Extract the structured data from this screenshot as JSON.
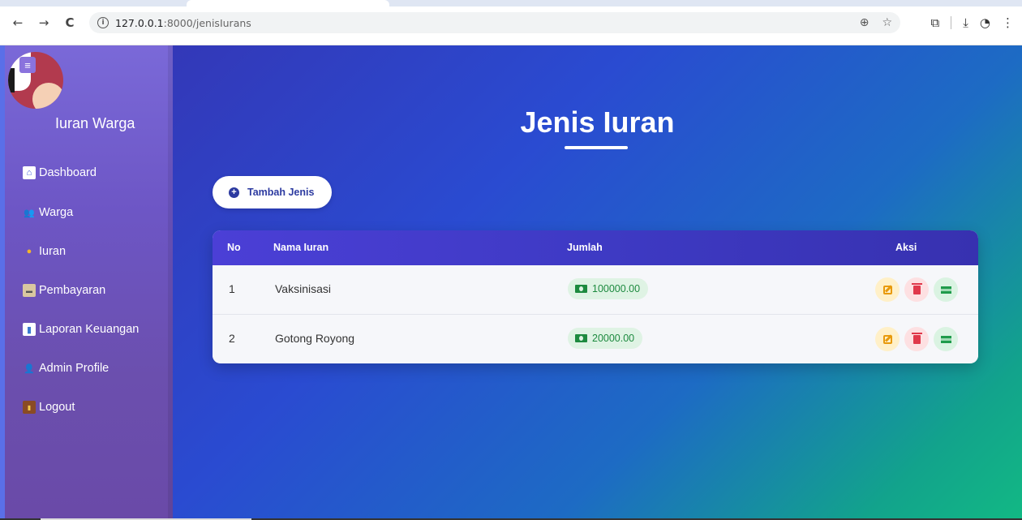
{
  "browser": {
    "url_host": "127.0.0.1",
    "url_path": ":8000/jenisIurans",
    "back_icon": "←",
    "forward_icon": "→",
    "reload_icon": "C"
  },
  "sidebar": {
    "brand": "Iuran Warga",
    "items": [
      {
        "label": "Dashboard",
        "icon": "home-icon"
      },
      {
        "label": "Warga",
        "icon": "users-icon"
      },
      {
        "label": "Iuran",
        "icon": "money-bag-icon"
      },
      {
        "label": "Pembayaran",
        "icon": "card-icon"
      },
      {
        "label": "Laporan Keuangan",
        "icon": "chart-icon"
      },
      {
        "label": "Admin Profile",
        "icon": "user-icon"
      },
      {
        "label": "Logout",
        "icon": "door-icon"
      }
    ]
  },
  "main": {
    "title": "Jenis Iuran",
    "add_button": "Tambah Jenis",
    "table": {
      "headers": [
        "No",
        "Nama Iuran",
        "Jumlah",
        "Aksi"
      ],
      "rows": [
        {
          "no": "1",
          "nama": "Vaksinisasi",
          "jumlah": "100000.00"
        },
        {
          "no": "2",
          "nama": "Gotong Royong",
          "jumlah": "20000.00"
        }
      ]
    }
  },
  "colors": {
    "accent": "#2c3aa0",
    "table_header": "#3e3ac4",
    "amount_bg": "#dff3e4",
    "amount_text": "#1d8a3f",
    "edit": "#e89a0c",
    "delete": "#e0384b",
    "pay": "#1f9b4b"
  }
}
